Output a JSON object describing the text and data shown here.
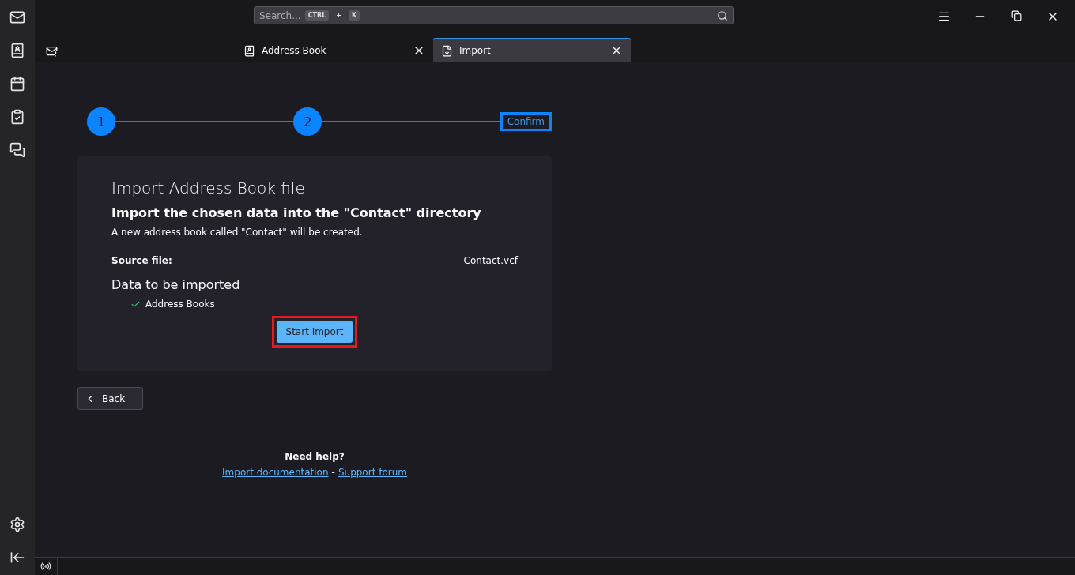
{
  "search": {
    "placeholder": "Search...",
    "shortcut": [
      "CTRL",
      "+",
      "K"
    ]
  },
  "tabs": [
    {
      "kind": "mail",
      "closable": false,
      "selected": false
    },
    {
      "kind": "addressbook",
      "label": "Address Book",
      "closable": true,
      "selected": false
    },
    {
      "kind": "import",
      "label": "Import",
      "closable": true,
      "selected": true
    }
  ],
  "steps": [
    {
      "label": "1",
      "selected": false
    },
    {
      "label": "2",
      "selected": false
    },
    {
      "label": "Confirm",
      "selected": true
    }
  ],
  "card": {
    "title": "Import Address Book file",
    "heading": "Import the chosen data into the \"Contact\" directory",
    "description": "A new address book called \"Contact\" will be created.",
    "source_label": "Source file:",
    "source_value": "Contact.vcf",
    "data_title": "Data to be imported",
    "items": [
      {
        "label": "Address Books",
        "checked": true
      }
    ],
    "start_button": "Start Import"
  },
  "back_button": "Back",
  "help": {
    "title": "Need help?",
    "links": [
      "Import documentation",
      "Support forum"
    ],
    "separator": "-"
  }
}
